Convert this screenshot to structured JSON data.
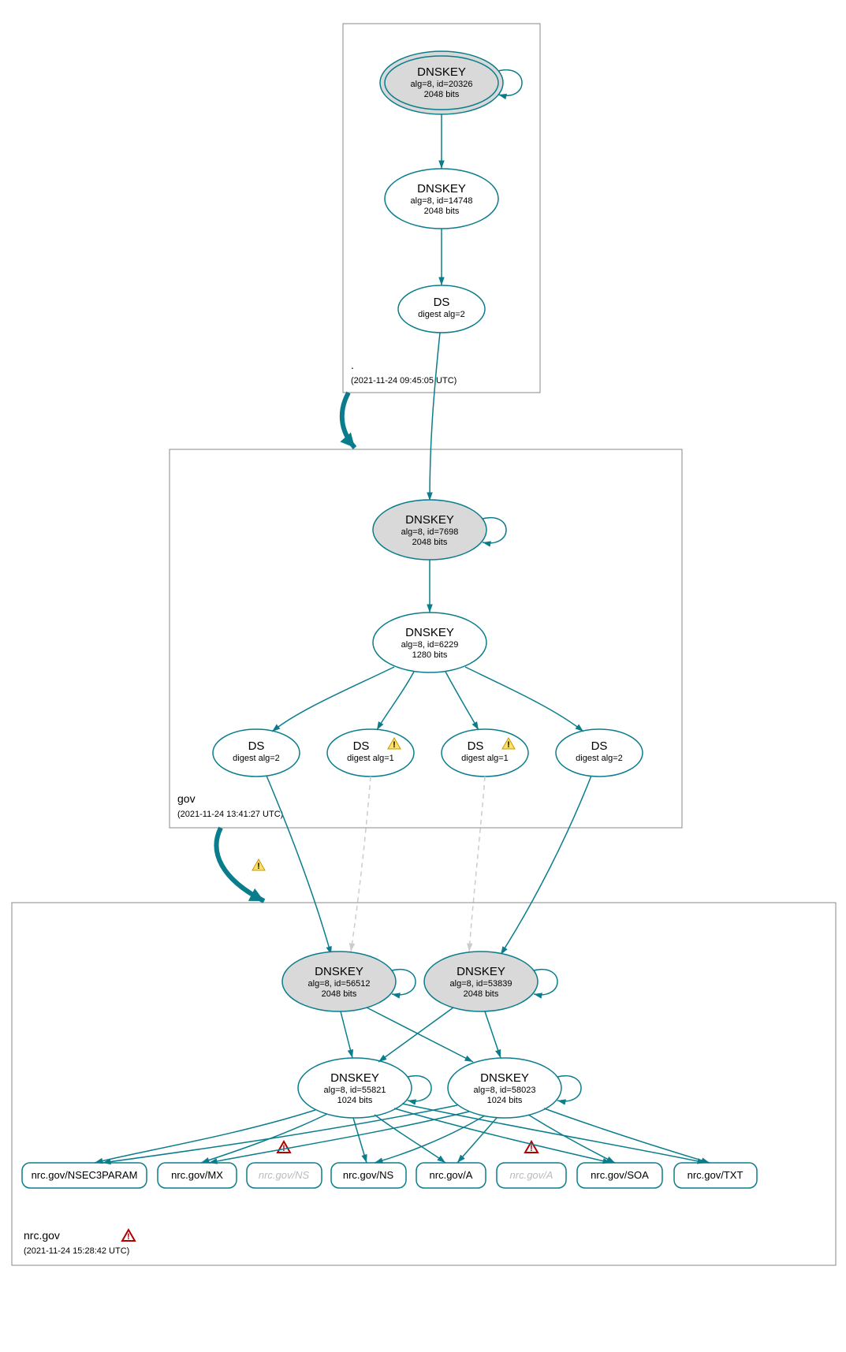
{
  "zones": {
    "root": {
      "name": ".",
      "timestamp": "(2021-11-24 09:45:05 UTC)"
    },
    "gov": {
      "name": "gov",
      "timestamp": "(2021-11-24 13:41:27 UTC)"
    },
    "nrcgov": {
      "name": "nrc.gov",
      "timestamp": "(2021-11-24 15:28:42 UTC)"
    }
  },
  "nodes": {
    "root_ksk": {
      "title": "DNSKEY",
      "l1": "alg=8, id=20326",
      "l2": "2048 bits"
    },
    "root_zsk": {
      "title": "DNSKEY",
      "l1": "alg=8, id=14748",
      "l2": "2048 bits"
    },
    "root_ds": {
      "title": "DS",
      "l1": "digest alg=2"
    },
    "gov_ksk": {
      "title": "DNSKEY",
      "l1": "alg=8, id=7698",
      "l2": "2048 bits"
    },
    "gov_zsk": {
      "title": "DNSKEY",
      "l1": "alg=8, id=6229",
      "l2": "1280 bits"
    },
    "gov_ds1": {
      "title": "DS",
      "l1": "digest alg=2"
    },
    "gov_ds2": {
      "title": "DS",
      "l1": "digest alg=1"
    },
    "gov_ds3": {
      "title": "DS",
      "l1": "digest alg=1"
    },
    "gov_ds4": {
      "title": "DS",
      "l1": "digest alg=2"
    },
    "nrc_ksk1": {
      "title": "DNSKEY",
      "l1": "alg=8, id=56512",
      "l2": "2048 bits"
    },
    "nrc_ksk2": {
      "title": "DNSKEY",
      "l1": "alg=8, id=53839",
      "l2": "2048 bits"
    },
    "nrc_zsk1": {
      "title": "DNSKEY",
      "l1": "alg=8, id=55821",
      "l2": "1024 bits"
    },
    "nrc_zsk2": {
      "title": "DNSKEY",
      "l1": "alg=8, id=58023",
      "l2": "1024 bits"
    }
  },
  "rrsets": {
    "rr0": "nrc.gov/NSEC3PARAM",
    "rr1": "nrc.gov/MX",
    "rr2": "nrc.gov/NS",
    "rr3": "nrc.gov/NS",
    "rr4": "nrc.gov/A",
    "rr5": "nrc.gov/A",
    "rr6": "nrc.gov/SOA",
    "rr7": "nrc.gov/TXT"
  }
}
